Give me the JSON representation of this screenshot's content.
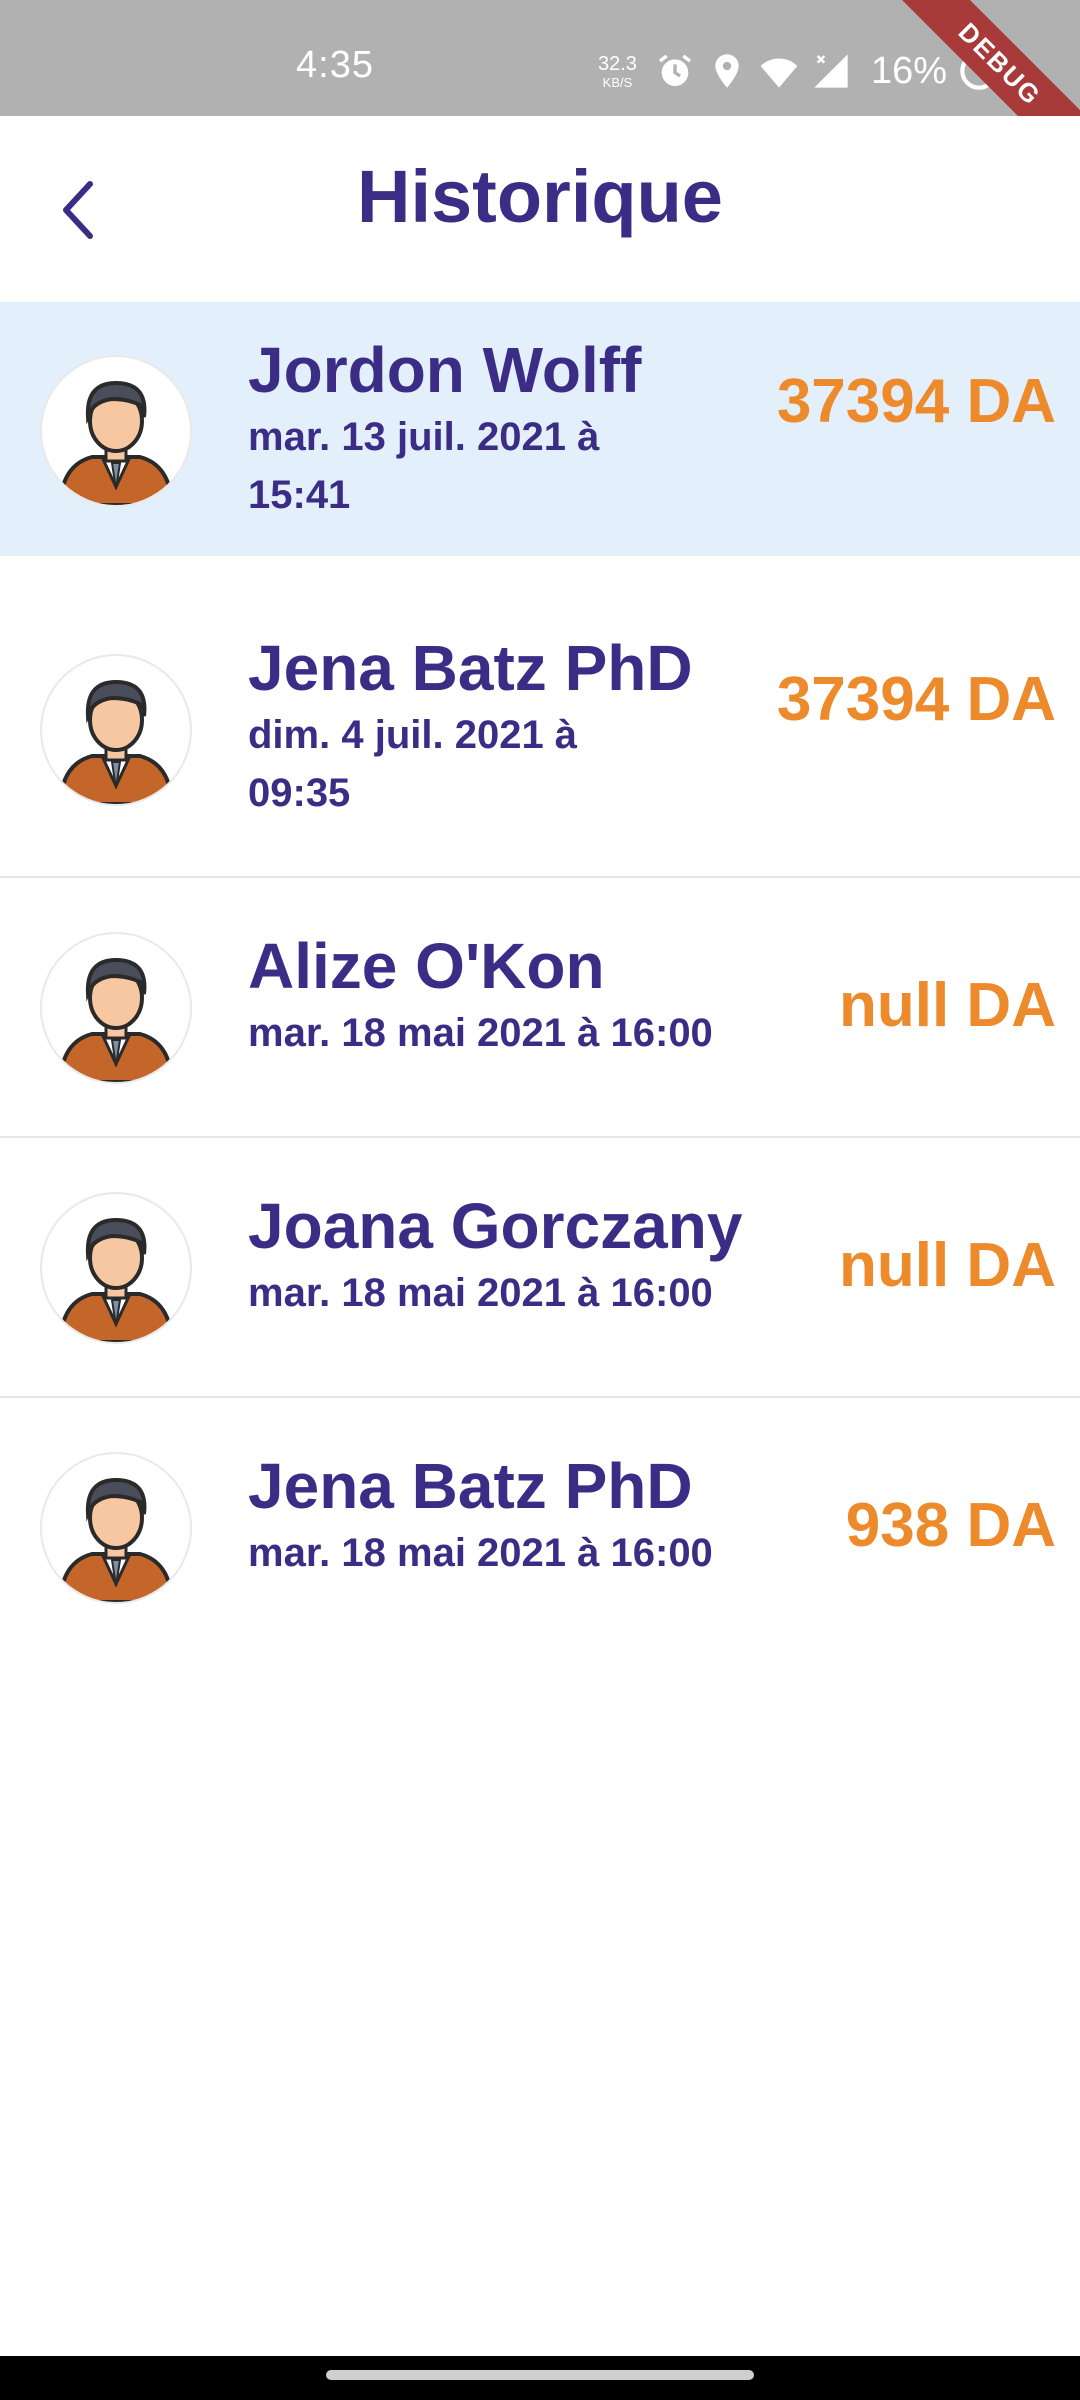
{
  "status_bar": {
    "time": "4:35",
    "net_speed_value": "32.3",
    "net_speed_unit": "KB/S",
    "battery_percent": "16%",
    "icons": [
      "alarm-icon",
      "location-icon",
      "wifi-icon",
      "signal-icon",
      "battery-icon"
    ]
  },
  "debug_banner": "DEBUG",
  "app_bar": {
    "back_icon": "chevron-left-icon",
    "title": "Historique"
  },
  "history": [
    {
      "name": "Jordon Wolff",
      "date_line1": "mar. 13 juil. 2021 à",
      "date_line2": "15:41",
      "amount": "37394 DA",
      "selected": true
    },
    {
      "name": "Jena Batz PhD",
      "date_line1": "dim. 4 juil. 2021 à",
      "date_line2": "09:35",
      "amount": "37394 DA",
      "selected": false
    },
    {
      "name": "Alize O'Kon",
      "date_line1": "mar. 18 mai 2021 à 16:00",
      "date_line2": "",
      "amount": "null DA",
      "selected": false
    },
    {
      "name": "Joana Gorczany",
      "date_line1": "mar. 18 mai 2021 à 16:00",
      "date_line2": "",
      "amount": "null DA",
      "selected": false
    },
    {
      "name": "Jena Batz PhD",
      "date_line1": "mar. 18 mai 2021 à 16:00",
      "date_line2": "",
      "amount": "938 DA",
      "selected": false
    }
  ],
  "colors": {
    "primary": "#3b2d86",
    "amount": "#ec8a2c",
    "selected_row": "#e3f0fb",
    "status_bar": "#b1b1b1"
  }
}
